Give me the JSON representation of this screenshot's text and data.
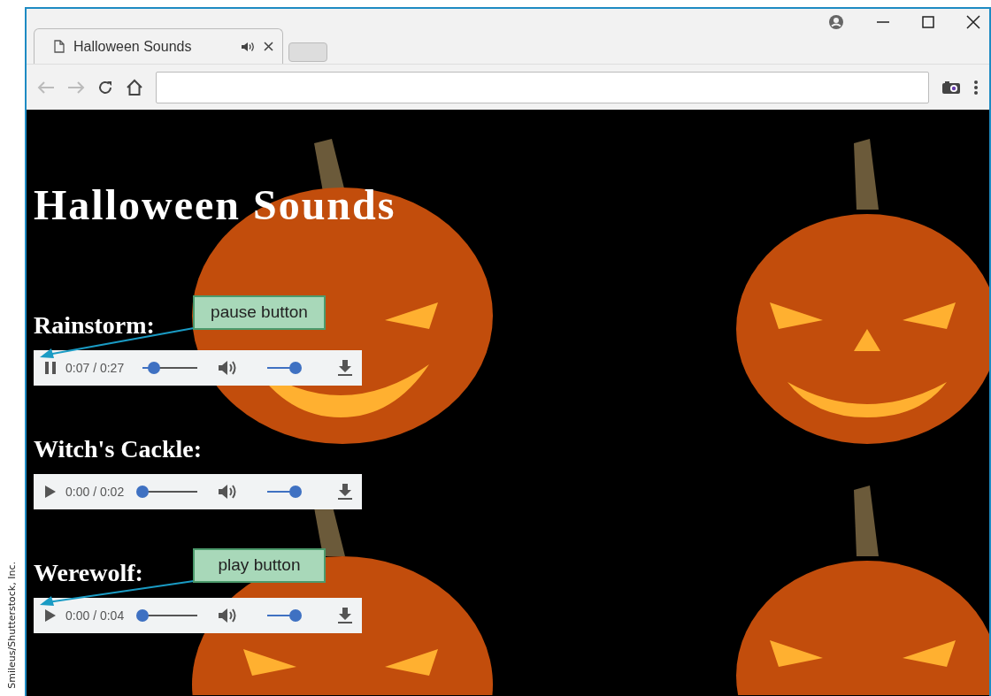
{
  "credit": "Smileus/Shutterstock, Inc.",
  "browser": {
    "tab_title": "Halloween Sounds",
    "tab_audio_playing": true
  },
  "page": {
    "title": "Halloween Sounds",
    "sounds": [
      {
        "name": "Rainstorm:",
        "playing": true,
        "time": "0:07 / 0:27",
        "level": 0.2,
        "volume": {
          "level": 0.85
        },
        "callout": "pause button"
      },
      {
        "name": "Witch's Cackle:",
        "playing": false,
        "time": "0:00 / 0:02",
        "level": 0.0,
        "volume": {
          "level": 0.85
        }
      },
      {
        "name": "Werewolf:",
        "playing": false,
        "time": "0:00 / 0:04",
        "level": 0.0,
        "volume": {
          "level": 0.85
        },
        "callout": "play button"
      }
    ]
  }
}
